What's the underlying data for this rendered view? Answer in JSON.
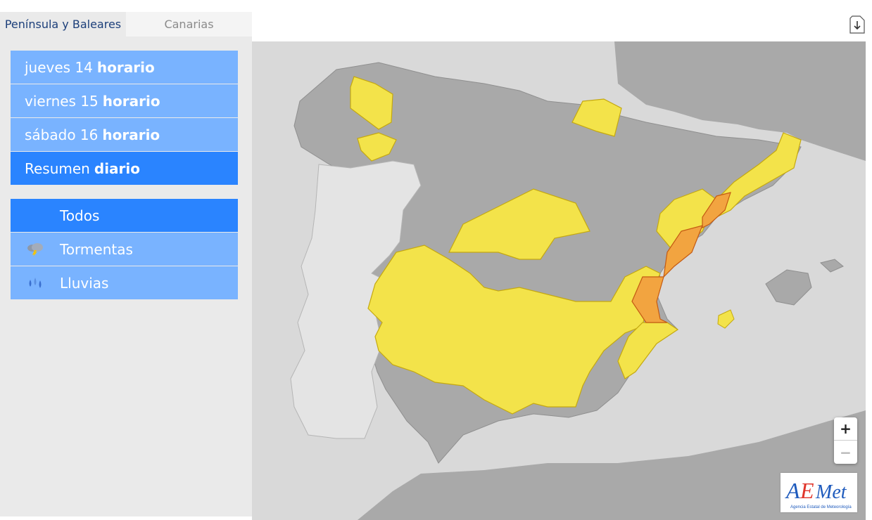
{
  "tabs": [
    {
      "label": "Península y Baleares",
      "active": true
    },
    {
      "label": "Canarias",
      "active": false
    }
  ],
  "days": [
    {
      "prefix": "jueves 14",
      "suffix": "horario"
    },
    {
      "prefix": "viernes 15",
      "suffix": "horario"
    },
    {
      "prefix": "sábado 16",
      "suffix": "horario"
    },
    {
      "prefix": "Resumen",
      "suffix": "diario",
      "selected": true
    }
  ],
  "phenomena": [
    {
      "label": "Todos",
      "icon": "none",
      "selected": true
    },
    {
      "label": "Tormentas",
      "icon": "storm-cloud-icon"
    },
    {
      "label": "Lluvias",
      "icon": "rain-drops-icon"
    }
  ],
  "zoom": {
    "in_label": "+",
    "out_label": "−"
  },
  "logo": {
    "name": "AEMet",
    "subtitle": "Agencia Estatal de Meteorología"
  },
  "colors": {
    "sea": "#d9d9d9",
    "land": "#a9a9a9",
    "portugal": "#e4e4e4",
    "warning_yellow": "#f3e34a",
    "warning_orange": "#f2a440",
    "menu_light": "#79b3ff",
    "menu_selected": "#2a84ff"
  }
}
